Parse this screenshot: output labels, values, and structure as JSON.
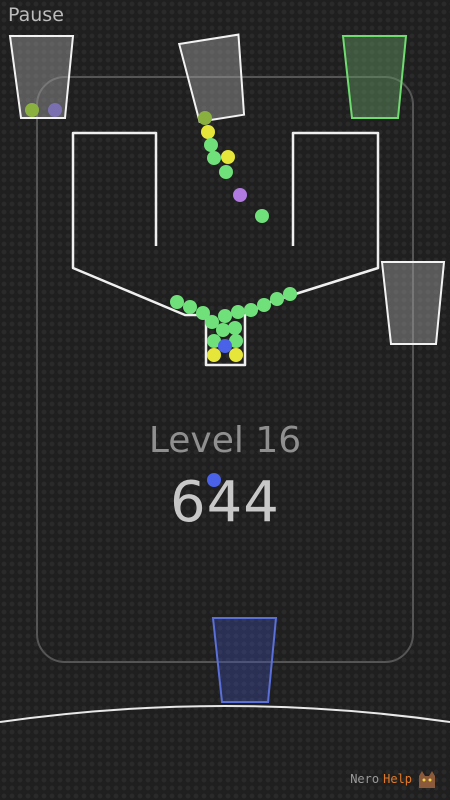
{
  "hud": {
    "pause_label": "Pause"
  },
  "level": {
    "label": "Level 16"
  },
  "score": {
    "value": "644"
  },
  "watermark": {
    "brand_part1": "Nero",
    "brand_part2": "Help"
  },
  "cups": [
    {
      "name": "cup-top-left",
      "color": "#8c8c8c",
      "filled": true
    },
    {
      "name": "cup-top-center",
      "color": "#8c8c8c",
      "filled": true
    },
    {
      "name": "cup-top-right-green",
      "color": "#6fdc6f",
      "filled": true
    },
    {
      "name": "cup-right",
      "color": "#cccccc",
      "filled": true
    },
    {
      "name": "cup-bottom-blue",
      "color": "#5a6fd8",
      "filled": true
    }
  ],
  "ball_colors": {
    "green": "#6fe07a",
    "yellow": "#e6e63a",
    "purple": "#b07ae0",
    "blue": "#4a62e8",
    "olive": "#8ab040"
  }
}
